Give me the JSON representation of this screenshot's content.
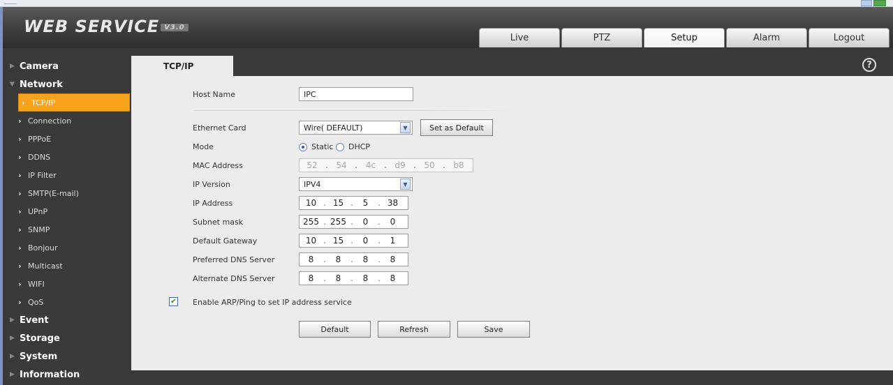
{
  "header": {
    "logo": "WEB SERVICE",
    "version": "V3.0",
    "tabs": [
      "Live",
      "PTZ",
      "Setup",
      "Alarm",
      "Logout"
    ]
  },
  "sidebar": {
    "camera": "Camera",
    "network": "Network",
    "sub": [
      "TCP/IP",
      "Connection",
      "PPPoE",
      "DDNS",
      "IP Filter",
      "SMTP(E-mail)",
      "UPnP",
      "SNMP",
      "Bonjour",
      "Multicast",
      "WIFI",
      "QoS"
    ],
    "event": "Event",
    "storage": "Storage",
    "system": "System",
    "information": "Information"
  },
  "page": {
    "tab": "TCP/IP",
    "help_glyph": "?"
  },
  "form": {
    "host_name_label": "Host Name",
    "host_name_value": "IPC",
    "ethernet_label": "Ethernet Card",
    "ethernet_value": "Wire( DEFAULT)",
    "set_default": "Set as Default",
    "mode_label": "Mode",
    "mode_static": "Static",
    "mode_dhcp": "DHCP",
    "mac_label": "MAC Address",
    "mac": [
      "52",
      "54",
      "4c",
      "d9",
      "50",
      "b8"
    ],
    "ipver_label": "IP Version",
    "ipver_value": "IPV4",
    "ip_label": "IP Address",
    "ip": [
      "10",
      "15",
      "5",
      "38"
    ],
    "mask_label": "Subnet mask",
    "mask": [
      "255",
      "255",
      "0",
      "0"
    ],
    "gw_label": "Default Gateway",
    "gw": [
      "10",
      "15",
      "0",
      "1"
    ],
    "dns1_label": "Preferred DNS Server",
    "dns1": [
      "8",
      "8",
      "8",
      "8"
    ],
    "dns2_label": "Alternate DNS Server",
    "dns2": [
      "8",
      "8",
      "8",
      "8"
    ],
    "arp_label": "Enable ARP/Ping to set IP address service",
    "btn_default": "Default",
    "btn_refresh": "Refresh",
    "btn_save": "Save"
  },
  "colors": {
    "accent": "#f7a21b",
    "header_dark": "#3d3d3d",
    "panel": "#ececec"
  }
}
